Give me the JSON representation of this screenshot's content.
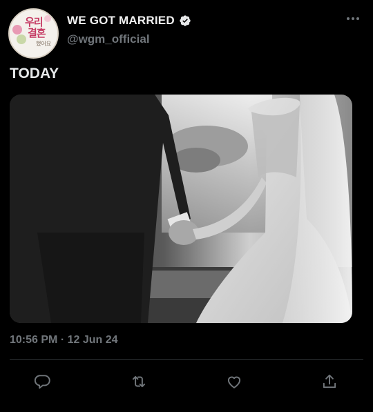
{
  "profile": {
    "display_name": "WE GOT MARRIED",
    "handle": "@wgm_official",
    "avatar_text_line1": "우리",
    "avatar_text_line2": "결혼",
    "avatar_text_line3": "했어요"
  },
  "tweet": {
    "text": "TODAY",
    "timestamp": "10:56 PM · 12 Jun 24"
  },
  "colors": {
    "background": "#000000",
    "secondary_text": "#71767b",
    "verified": "#e7e9ea"
  },
  "actions": [
    {
      "icon": "reply-icon"
    },
    {
      "icon": "retweet-icon"
    },
    {
      "icon": "like-icon"
    },
    {
      "icon": "share-icon"
    }
  ]
}
